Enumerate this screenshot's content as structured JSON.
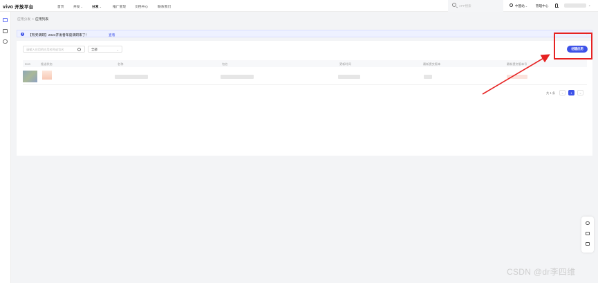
{
  "nav": {
    "logo": "vivo",
    "logo_sub": "开放平台",
    "items": [
      {
        "label": "首页",
        "has_menu": false
      },
      {
        "label": "开发",
        "has_menu": true
      },
      {
        "label": "分发",
        "has_menu": true,
        "active": true
      },
      {
        "label": "推广变现",
        "has_menu": false
      },
      {
        "label": "文档中心",
        "has_menu": false
      },
      {
        "label": "联系我们",
        "has_menu": false
      }
    ],
    "search_placeholder": "APP搜索",
    "region": "中国站",
    "manage": "管理中心"
  },
  "breadcrumb": {
    "root": "应用分发",
    "sep": ">",
    "current": "应用列表"
  },
  "banner": {
    "text": "【有奖调研】2024开发者年度调研来了！",
    "link": "查看",
    "close": "×"
  },
  "toolbar": {
    "search_placeholder": "请输入应用的应用名称或包名",
    "filter_value": "全部",
    "create_button": "创建应用"
  },
  "table": {
    "headers": [
      "Icon",
      "推送状态",
      "名称",
      "包名",
      "更新时间",
      "最新提交版本",
      "最新提交版本号"
    ]
  },
  "pagination": {
    "total": "共 1 条",
    "prev": "<",
    "page": "1",
    "next": ">"
  },
  "watermark": "CSDN @dr李四维",
  "colors": {
    "accent": "#3d52e8",
    "annotation": "#e62222"
  }
}
